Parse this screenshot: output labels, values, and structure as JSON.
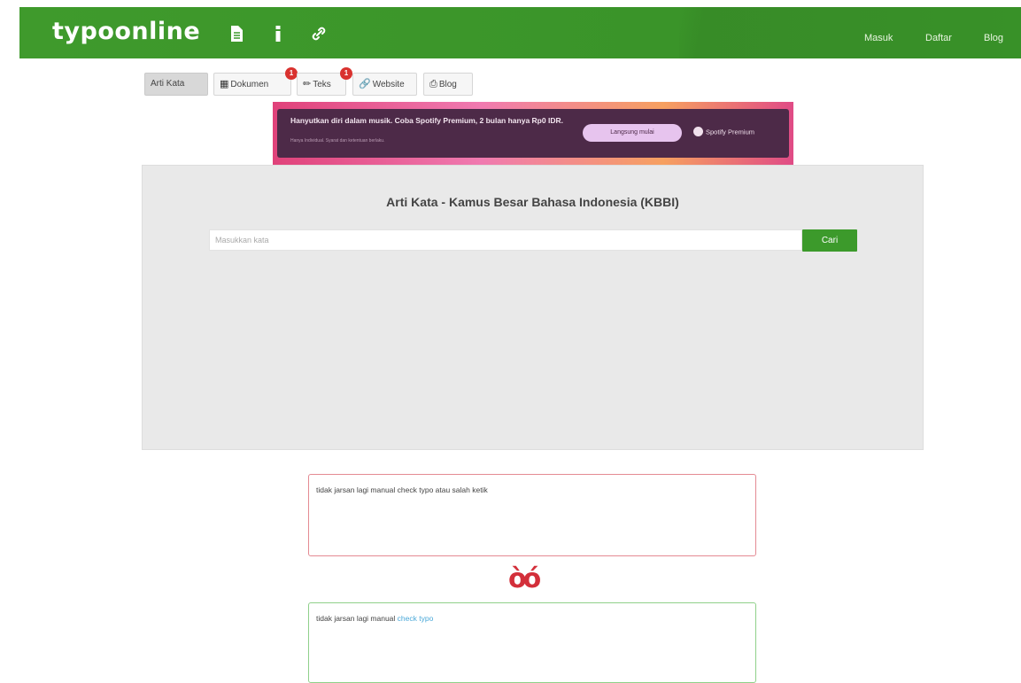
{
  "header": {
    "logo": "typoonline",
    "nav": [
      "Masuk",
      "Daftar",
      "Blog"
    ]
  },
  "tabs": [
    {
      "label": "Arti Kata",
      "icon": "",
      "badge": null,
      "active": true
    },
    {
      "label": "Dokumen",
      "icon": "document-icon",
      "badge": "1",
      "active": false
    },
    {
      "label": "Teks",
      "icon": "pencil-icon",
      "badge": "1",
      "active": false
    },
    {
      "label": "Website",
      "icon": "link-icon",
      "badge": null,
      "active": false
    },
    {
      "label": "Blog",
      "icon": "print-icon",
      "badge": null,
      "active": false
    }
  ],
  "ad": {
    "headline": "Hanyutkan diri dalam musik. Coba Spotify Premium, 2 bulan hanya Rp0 IDR.",
    "fine_print": "Hanya Individual. Syarat dan ketentuan berlaku.",
    "button": "Langsung mulai",
    "brand": "Spotify Premium"
  },
  "main": {
    "title": "Arti Kata - Kamus Besar Bahasa Indonesia (KBBI)",
    "search_placeholder": "Masukkan kata",
    "search_button": "Cari"
  },
  "examples": {
    "wrong_text": "tidak jarsan lagi manual check typo atau salah ketik",
    "correct_text_before": "tidak jarsan lagi manual ",
    "correct_text_highlight": "check typo"
  },
  "colors": {
    "brand_green": "#3c9a2b",
    "error_red": "#d32f3a",
    "error_border": "#e48a93",
    "success_border": "#8fd08a",
    "highlight_blue": "#4aa8d8"
  }
}
